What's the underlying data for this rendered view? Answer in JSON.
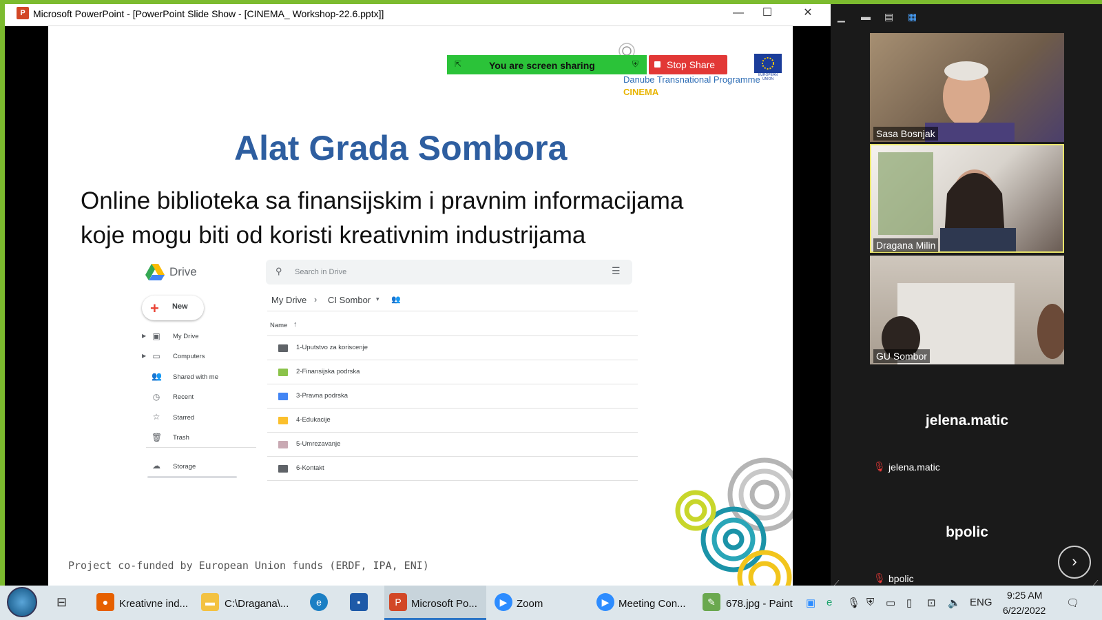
{
  "ppt": {
    "title": "Microsoft PowerPoint - [PowerPoint Slide Show - [CINEMA_ Workshop-22.6.pptx]]",
    "controls": {
      "minimize": "—",
      "maximize": "☐",
      "close": "✕"
    }
  },
  "slide": {
    "title": "Alat Grada Sombora",
    "subtitle_line1": "Online biblioteka sa finansijskim i pravnim informacijama",
    "subtitle_line2": "koje mogu biti od koristi kreativnim industrijama",
    "footer": "Project co-funded by European Union funds (ERDF, IPA, ENI)",
    "program": "Danube Transnational Programme",
    "project": "CINEMA",
    "eu_label": "EUROPEAN UNION",
    "colors": {
      "title": "#2e5ea0",
      "program": "#2e6db5",
      "project": "#e8b400"
    }
  },
  "drive": {
    "logo_text": "Drive",
    "search_placeholder": "Search in Drive",
    "new_label": "New",
    "nav": [
      {
        "label": "My Drive",
        "icon": "my-drive-icon"
      },
      {
        "label": "Computers",
        "icon": "computers-icon"
      },
      {
        "label": "Shared with me",
        "icon": "shared-icon"
      },
      {
        "label": "Recent",
        "icon": "clock-icon"
      },
      {
        "label": "Starred",
        "icon": "star-icon"
      },
      {
        "label": "Trash",
        "icon": "trash-icon"
      },
      {
        "label": "Storage",
        "icon": "cloud-icon"
      }
    ],
    "breadcrumb": {
      "root": "My Drive",
      "sep": "›",
      "folder": "CI Sombor"
    },
    "column_name": "Name",
    "files": [
      {
        "name": "1-Uputstvo za koriscenje",
        "color": "#5f6368"
      },
      {
        "name": "2-Finansijska podrska",
        "color": "#8bc34a"
      },
      {
        "name": "3-Pravna podrska",
        "color": "#4285f4"
      },
      {
        "name": "4-Edukacije",
        "color": "#fbc02d"
      },
      {
        "name": "5-Umrezavanje",
        "color": "#c9a9b3"
      },
      {
        "name": "6-Kontakt",
        "color": "#5f6368"
      }
    ]
  },
  "share": {
    "status": "You are screen sharing",
    "stop_label": "Stop Share"
  },
  "zoom": {
    "participants": [
      {
        "name": "Sasa Bosnjak",
        "video": true
      },
      {
        "name": "Dragana Milin",
        "video": true,
        "active_speaker": true
      },
      {
        "name": "GU Sombor",
        "video": true
      },
      {
        "name": "jelena.matic",
        "video": false,
        "muted": true
      },
      {
        "name": "bpolic",
        "video": false,
        "muted": true
      }
    ],
    "next_label": "›"
  },
  "taskbar": {
    "items": [
      {
        "label": "Kreativne ind...",
        "icon": "firefox-icon",
        "color": "#e66000"
      },
      {
        "label": "C:\\Dragana\\...",
        "icon": "folder-icon",
        "color": "#f3c242"
      },
      {
        "label": "Microsoft Po...",
        "icon": "powerpoint-icon",
        "color": "#d24726"
      },
      {
        "label": "Zoom",
        "icon": "zoom-icon",
        "color": "#2d8cff"
      },
      {
        "label": "Meeting Con...",
        "icon": "zoom-meeting-icon",
        "color": "#2d8cff"
      },
      {
        "label": "678.jpg - Paint",
        "icon": "paint-icon",
        "color": "#6aa84f"
      }
    ],
    "language": "ENG",
    "time": "9:25 AM",
    "date": "6/22/2022"
  }
}
